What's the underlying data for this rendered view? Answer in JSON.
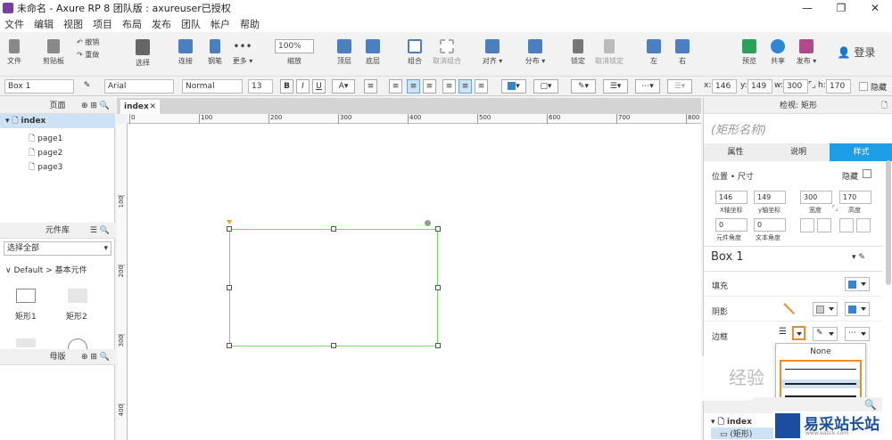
{
  "titlebar": {
    "title": "未命名 - Axure RP 8 团队版 : axureuser已授权",
    "minimize": "—",
    "restore": "❐",
    "close": "✕"
  },
  "menu": [
    "文件",
    "编辑",
    "视图",
    "项目",
    "布局",
    "发布",
    "团队",
    "帐户",
    "帮助"
  ],
  "toolbar": {
    "file": "文件",
    "clipboard": "剪贴板",
    "cut_label": "撤销",
    "redo_label": "重做",
    "select": "选择",
    "connect": "连接",
    "pen": "钢笔",
    "more": "更多 ▾",
    "zoom_value": "100%",
    "zoom": "缩放",
    "top": "顶层",
    "bottom": "底层",
    "group": "组合",
    "ungroup": "取消组合",
    "align": "对齐 ▾",
    "distribute": "分布 ▾",
    "lock": "锁定",
    "unlock": "取消锁定",
    "left": "左",
    "right": "右",
    "preview": "预览",
    "share": "共享",
    "publish": "发布 ▾",
    "login": "登录"
  },
  "formatbar": {
    "widget_name": "Box 1",
    "font": "Arial",
    "style": "Normal",
    "size": "13",
    "x_label": "x:",
    "x": "146",
    "y_label": "y:",
    "y": "149",
    "w_label": "w:",
    "w": "300",
    "h_label": "h:",
    "h": "170",
    "hidden": "隐藏"
  },
  "pages_panel": {
    "title": "页面",
    "root": "index",
    "pages": [
      "page1",
      "page2",
      "page3"
    ]
  },
  "library_panel": {
    "title": "元件库",
    "select": "选择全部",
    "group": "Default > 基本元件",
    "items": [
      "矩形1",
      "矩形2"
    ]
  },
  "master_panel": {
    "title": "母版"
  },
  "canvas": {
    "tab": "index",
    "ruler_h": [
      "0",
      "100",
      "200",
      "300",
      "400",
      "500",
      "600",
      "700",
      "800"
    ],
    "ruler_v": [
      "100",
      "200",
      "300",
      "400"
    ]
  },
  "inspector": {
    "header": "检视: 矩形",
    "shape_name": "(矩形名称)",
    "tabs": [
      "属性",
      "说明",
      "样式"
    ],
    "position_size": "位置 • 尺寸",
    "hidden": "隐藏",
    "x": "146",
    "y": "149",
    "w": "300",
    "h": "170",
    "x_cap": "X轴坐标",
    "y_cap": "y轴坐标",
    "w_cap": "宽度",
    "h_cap": "高度",
    "rot1": "0",
    "rot2": "0",
    "rot1_cap": "元件角度",
    "rot2_cap": "文本角度",
    "style_name": "Box 1",
    "fill": "填充",
    "shadow": "阴影",
    "border": "边框",
    "dropdown_first": "None",
    "outline_index": "index",
    "outline_item": "(矩形)"
  },
  "watermark": {
    "brand": "易采站长站",
    "url": "www.easck.com",
    "jingyan": "经验"
  },
  "colors": {
    "accent": "#1e9ee6",
    "selection": "#7bd36a",
    "fillswatch": "#2e86d4",
    "orange": "#f08a24"
  }
}
